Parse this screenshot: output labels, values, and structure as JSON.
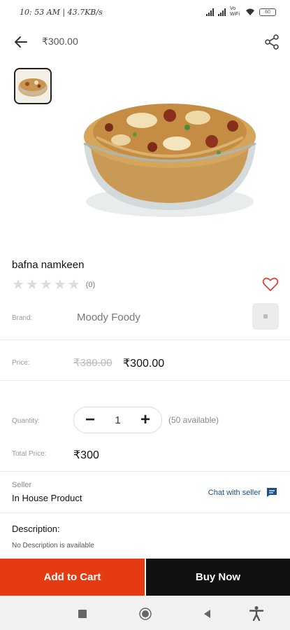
{
  "status": {
    "left_text": "10: 53 AM | 43.7KB/s",
    "carrier_text": "Vo WiFi",
    "battery_text": "60"
  },
  "header": {
    "title": "₹300.00",
    "back_icon": "arrow-left-icon",
    "share_icon": "share-icon"
  },
  "product": {
    "name": "bafna namkeen",
    "rating_count": "(0)",
    "rating": 0,
    "max_rating": 5,
    "image": "bowl-of-namkeen-snack-mix"
  },
  "brand": {
    "label": "Brand:",
    "value": "Moody Foody"
  },
  "price": {
    "label": "Price:",
    "old": "₹380.00",
    "new": "₹300.00"
  },
  "quantity": {
    "label": "Quantity:",
    "value": "1",
    "minus": "−",
    "plus": "+",
    "available": "(50 available)"
  },
  "total": {
    "label": "Total Price:",
    "value": "₹300"
  },
  "seller": {
    "label": "Seller",
    "value": "In House Product",
    "chat_label": "Chat with seller"
  },
  "description": {
    "title": "Description:",
    "text": "No Description is available"
  },
  "actions": {
    "add_to_cart": "Add to Cart",
    "buy_now": "Buy Now"
  },
  "colors": {
    "accent": "#e53a12",
    "dark": "#111111",
    "link": "#1a4f8a",
    "wishlist": "#e0453a"
  }
}
